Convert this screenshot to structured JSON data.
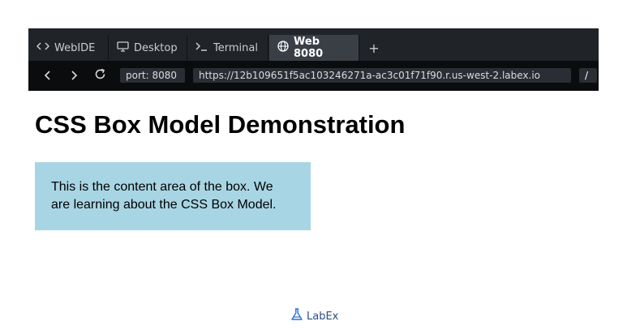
{
  "tabs": [
    {
      "label": "WebIDE",
      "icon": "code-icon",
      "active": false
    },
    {
      "label": "Desktop",
      "icon": "monitor-icon",
      "active": false
    },
    {
      "label": "Terminal",
      "icon": "terminal-icon",
      "active": false
    },
    {
      "label": "Web 8080",
      "icon": "globe-icon",
      "active": true
    }
  ],
  "new_tab_label": "+",
  "nav": {
    "port_label": "port: 8080",
    "url": "https://12b109651f5ac103246271a-ac3c01f71f90.r.us-west-2.labex.io",
    "path": "/"
  },
  "page": {
    "heading": "CSS Box Model Demonstration",
    "box_text": "This is the content area of the box. We are learning about the CSS Box Model."
  },
  "footer": {
    "brand": "LabEx",
    "icon": "flask-icon"
  },
  "colors": {
    "box_background": "#a8d5e3",
    "tab_active": "#3a3f46",
    "frame": "#121418"
  }
}
